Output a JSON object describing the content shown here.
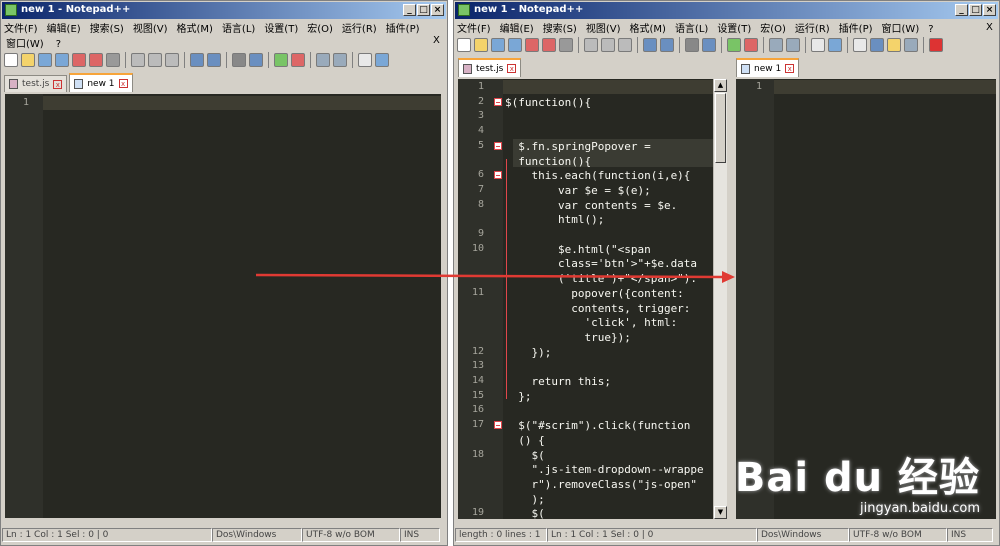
{
  "left": {
    "title": "new 1 - Notepad++",
    "menu": [
      "文件(F)",
      "编辑(E)",
      "搜索(S)",
      "视图(V)",
      "格式(M)",
      "语言(L)",
      "设置(T)",
      "宏(O)",
      "运行(R)",
      "插件(P)"
    ],
    "menu2": [
      "窗口(W)",
      "?"
    ],
    "menu_close": "X",
    "tabs": [
      {
        "label": "test.js"
      },
      {
        "label": "new 1"
      }
    ],
    "line_number": "1",
    "status": [
      "Ln : 1    Col : 1    Sel : 0 | 0",
      "Dos\\Windows",
      "UTF-8 w/o BOM",
      "INS"
    ]
  },
  "right": {
    "title": "new 1 - Notepad++",
    "menu": [
      "文件(F)",
      "编辑(E)",
      "搜索(S)",
      "视图(V)",
      "格式(M)",
      "语言(L)",
      "设置(T)",
      "宏(O)",
      "运行(R)",
      "插件(P)",
      "窗口(W)",
      "?"
    ],
    "menu_close": "X",
    "left_tab": "test.js",
    "right_tab": "new 1",
    "right_line_number": "1",
    "code_lines": [
      {
        "n": "1",
        "t": ""
      },
      {
        "n": "2",
        "t": "$(function(){"
      },
      {
        "n": "3",
        "t": ""
      },
      {
        "n": "4",
        "t": ""
      },
      {
        "n": "5",
        "t": "  $.fn.springPopover ="
      },
      {
        "n": "",
        "t": "  function(){"
      },
      {
        "n": "6",
        "t": "    this.each(function(i,e){"
      },
      {
        "n": "7",
        "t": "        var $e = $(e);"
      },
      {
        "n": "8",
        "t": "        var contents = $e."
      },
      {
        "n": "",
        "t": "        html();"
      },
      {
        "n": "9",
        "t": ""
      },
      {
        "n": "10",
        "t": "        $e.html(\"<span"
      },
      {
        "n": "",
        "t": "        class='btn'>\"+$e.data"
      },
      {
        "n": "",
        "t": "        ('title')+\"</span>\")."
      },
      {
        "n": "11",
        "t": "          popover({content:"
      },
      {
        "n": "",
        "t": "          contents, trigger:"
      },
      {
        "n": "",
        "t": "            'click', html:"
      },
      {
        "n": "",
        "t": "            true});"
      },
      {
        "n": "12",
        "t": "    });"
      },
      {
        "n": "13",
        "t": ""
      },
      {
        "n": "14",
        "t": "    return this;"
      },
      {
        "n": "15",
        "t": "  };"
      },
      {
        "n": "16",
        "t": ""
      },
      {
        "n": "17",
        "t": "  $(\"#scrim\").click(function"
      },
      {
        "n": "",
        "t": "  () {"
      },
      {
        "n": "18",
        "t": "    $("
      },
      {
        "n": "",
        "t": "    \".js-item-dropdown--wrappe"
      },
      {
        "n": "",
        "t": "    r\").removeClass(\"js-open\""
      },
      {
        "n": "",
        "t": "    );"
      },
      {
        "n": "19",
        "t": "    $("
      }
    ],
    "status": [
      "length : 0    lines : 1",
      "Ln : 1    Col : 1    Sel : 0 | 0",
      "Dos\\Windows",
      "UTF-8 w/o BOM",
      "INS"
    ]
  },
  "watermark": {
    "brand": "Bai du 经验",
    "url": "jingyan.baidu.com"
  },
  "colors": {
    "editor_bg": "#272822",
    "gutter_bg": "#2f302a",
    "arrow": "#e03a33",
    "fold": "#e0464b",
    "title_start": "#0a246a"
  }
}
